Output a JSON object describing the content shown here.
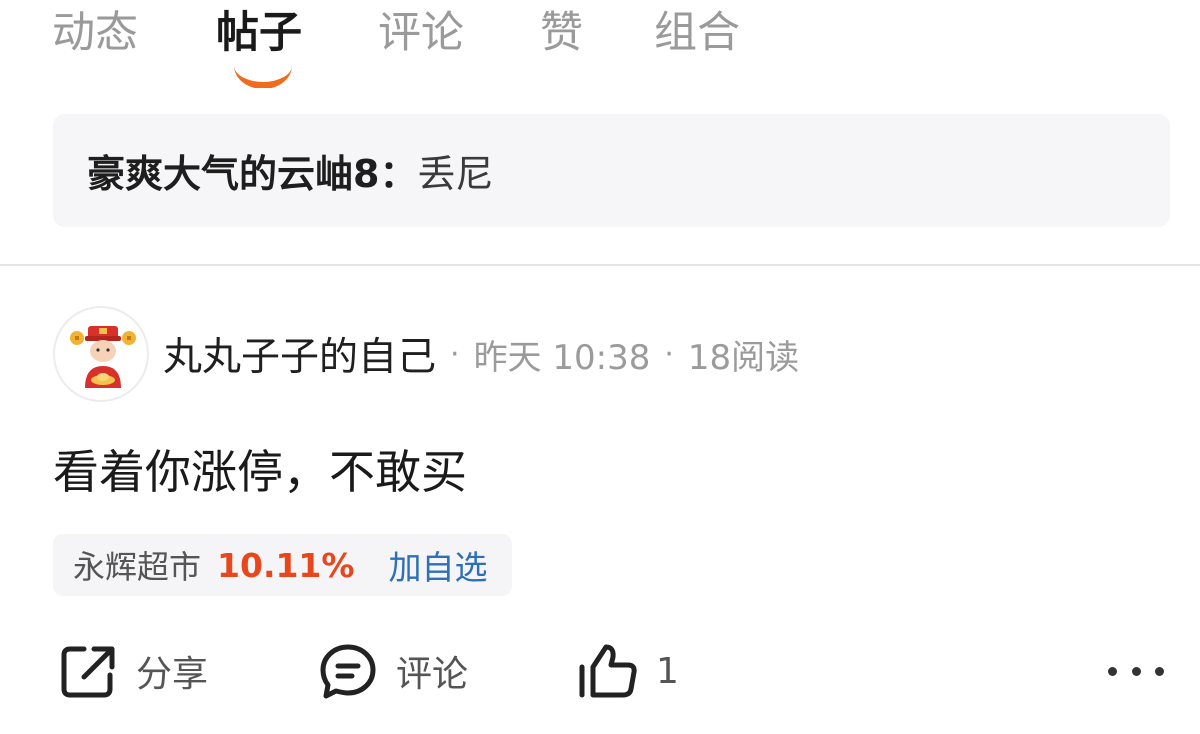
{
  "tabs": [
    {
      "label": "动态",
      "active": false
    },
    {
      "label": "帖子",
      "active": true
    },
    {
      "label": "评论",
      "active": false
    },
    {
      "label": "赞",
      "active": false
    },
    {
      "label": "组合",
      "active": false
    }
  ],
  "accent_color": "#f26a1b",
  "quote": {
    "author": "豪爽大气的云岫8",
    "separator": "：",
    "text": "丢尼"
  },
  "post": {
    "avatar_icon": "fortune-god-avatar",
    "author": "丸丸子子的自己",
    "dot": "·",
    "time": "昨天 10:38",
    "reads": "18阅读",
    "body": "看着你涨停，不敢买"
  },
  "stock": {
    "name": "永辉超市",
    "change": "10.11%",
    "change_color": "#e8461c",
    "add_label": "加自选",
    "add_color": "#2d6fb8"
  },
  "actions": {
    "share_icon": "share-icon",
    "share_label": "分享",
    "comment_icon": "comment-icon",
    "comment_label": "评论",
    "like_icon": "thumbs-up-icon",
    "like_count": "1",
    "more_icon": "more-icon"
  }
}
